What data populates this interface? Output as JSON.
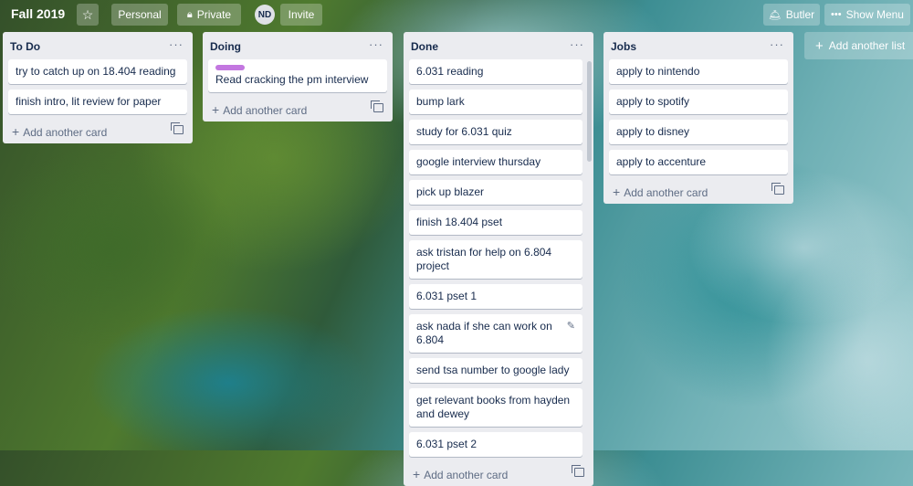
{
  "header": {
    "board_title": "Fall 2019",
    "star_icon": "star-icon",
    "personal_label": "Personal",
    "private_label": "Private",
    "avatar_initials": "ND",
    "invite_label": "Invite",
    "butler_label": "Butler",
    "show_menu_label": "Show Menu"
  },
  "lists": [
    {
      "title": "To Do",
      "cards": [
        {
          "text": "try to catch up on 18.404 reading"
        },
        {
          "text": "finish intro, lit review for paper"
        }
      ],
      "add_label": "Add another card"
    },
    {
      "title": "Doing",
      "cards": [
        {
          "text": "Read cracking the pm interview",
          "label_color": "#c377e0"
        }
      ],
      "add_label": "Add another card"
    },
    {
      "title": "Done",
      "cards": [
        {
          "text": "6.031 reading"
        },
        {
          "text": "bump lark"
        },
        {
          "text": "study for 6.031 quiz"
        },
        {
          "text": "google interview thursday"
        },
        {
          "text": "pick up blazer"
        },
        {
          "text": "finish 18.404 pset"
        },
        {
          "text": "ask tristan for help on 6.804 project"
        },
        {
          "text": "6.031 pset 1"
        },
        {
          "text": "ask nada if she can work on 6.804"
        },
        {
          "text": "send tsa number to google lady"
        },
        {
          "text": "get relevant books from hayden and dewey"
        },
        {
          "text": "6.031 pset 2"
        }
      ],
      "add_label": "Add another card"
    },
    {
      "title": "Jobs",
      "cards": [
        {
          "text": "apply to nintendo"
        },
        {
          "text": "apply to spotify"
        },
        {
          "text": "apply to disney"
        },
        {
          "text": "apply to accenture"
        }
      ],
      "add_label": "Add another card"
    }
  ],
  "add_list_label": "Add another list",
  "menu_icon": "ellipsis-icon"
}
